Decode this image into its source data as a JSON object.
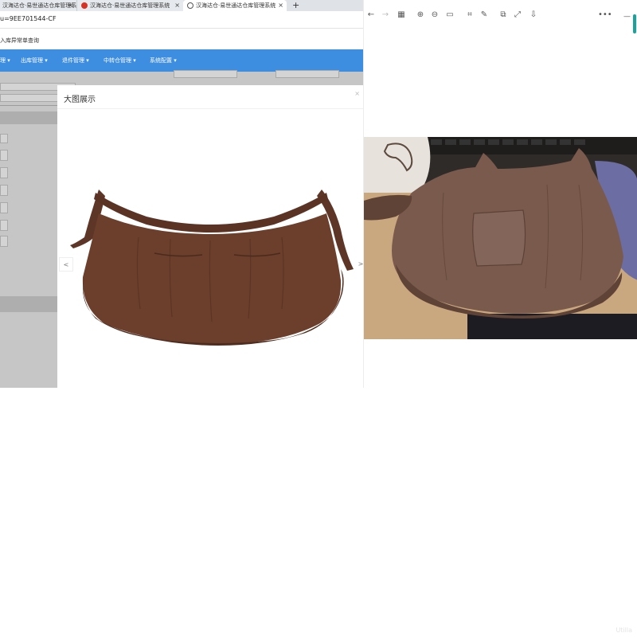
{
  "browser": {
    "tabs": [
      {
        "label": "汉海达仓·易世通达仓库管理系统"
      },
      {
        "label": "汉海达仓·易世通达仓库管理系统"
      },
      {
        "label": "汉海达仓·易世通达仓库管理系统"
      }
    ],
    "new_tab": "+",
    "address_fragment": "u=9EE701544-CF",
    "bookmark_fragment": "入库异常单查询"
  },
  "app_nav": {
    "items": [
      {
        "label": "理 ▾"
      },
      {
        "label": "出库管理 ▾"
      },
      {
        "label": "退件管理 ▾"
      },
      {
        "label": "中转仓管理 ▾"
      },
      {
        "label": "系统配置 ▾"
      }
    ]
  },
  "modal": {
    "title": "大图展示",
    "close": "×",
    "prev": "<",
    "next": ">"
  },
  "viewer": {
    "toolbar_icons": [
      "arrow-left-icon",
      "arrow-right-icon",
      "grid-icon",
      "zoom-in-icon",
      "zoom-out-icon",
      "fit-icon",
      "crop-icon",
      "edit-icon",
      "copy-icon",
      "fullscreen-icon",
      "save-icon",
      "more-icon"
    ],
    "window_controls": {
      "minimize": "—",
      "more": "•••"
    }
  },
  "watermark": "Utilla",
  "colors": {
    "nav_blue": "#3d8ee0",
    "apron_brown": "#6b3f2c",
    "accent_teal": "#1aa39a"
  }
}
